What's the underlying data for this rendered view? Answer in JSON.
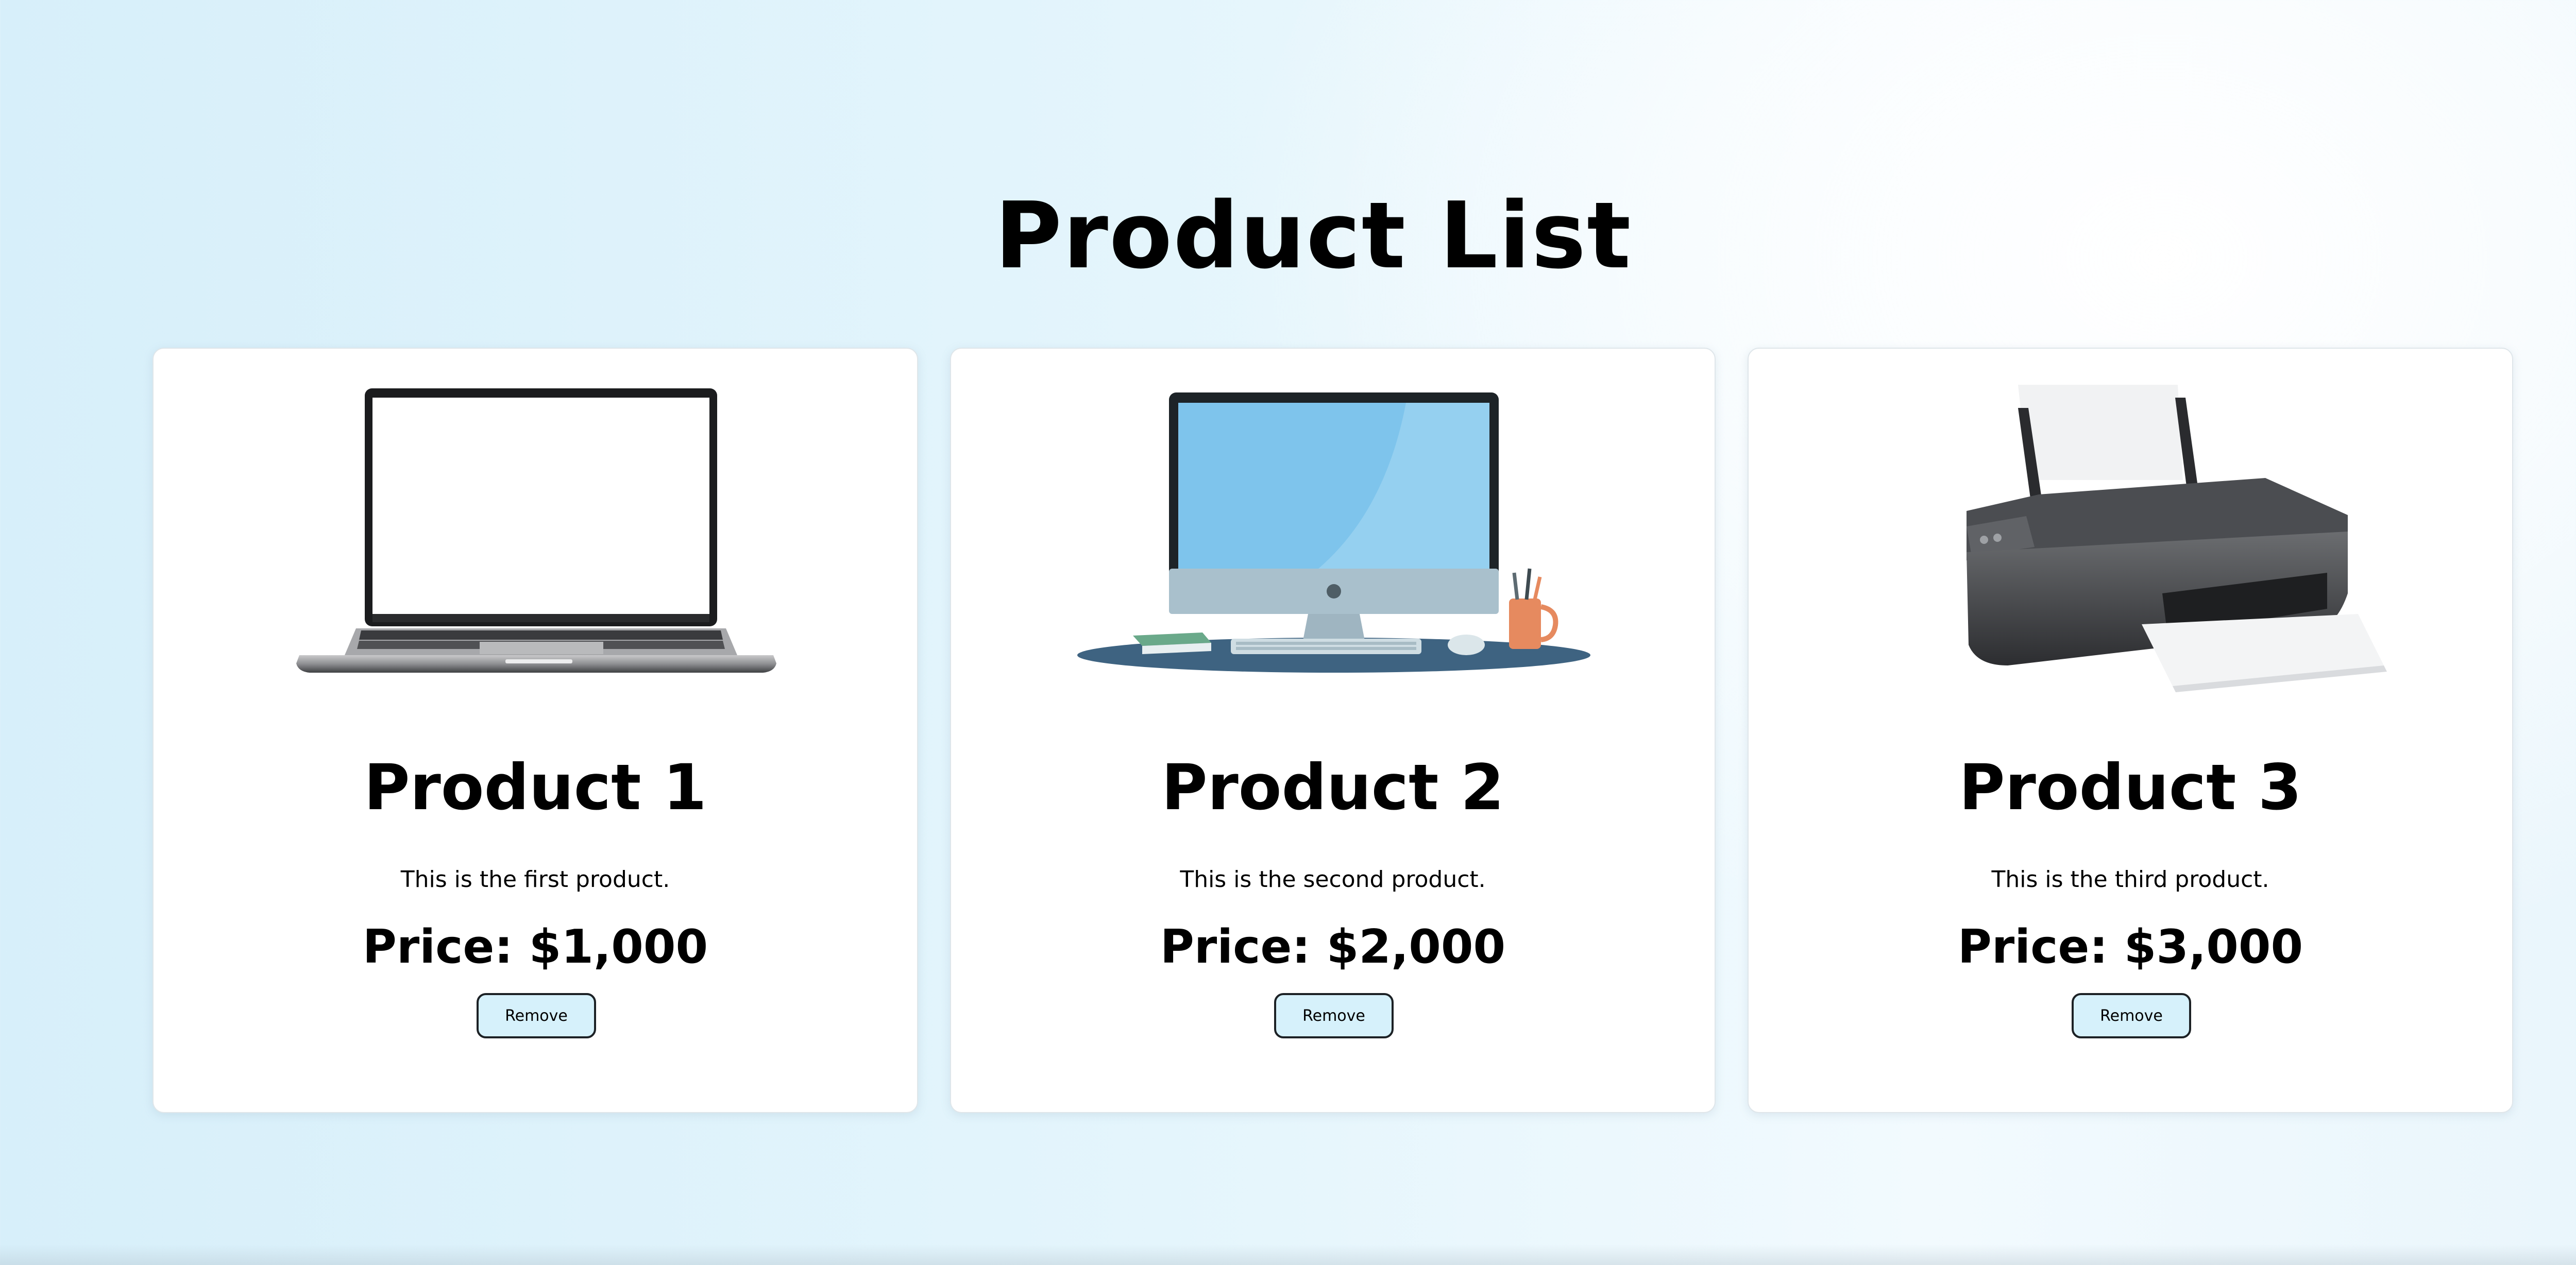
{
  "page": {
    "title": "Product List"
  },
  "products": [
    {
      "name": "Product 1",
      "description": "This is the first product.",
      "price": "Price: $1,000",
      "image_icon": "laptop-icon",
      "button_label": "Remove"
    },
    {
      "name": "Product 2",
      "description": "This is the second product.",
      "price": "Price: $2,000",
      "image_icon": "desktop-computer-icon",
      "button_label": "Remove"
    },
    {
      "name": "Product 3",
      "description": "This is the third product.",
      "price": "Price: $3,000",
      "image_icon": "printer-icon",
      "button_label": "Remove"
    }
  ],
  "colors": {
    "button_background": "#d6f1fb",
    "card_background": "#ffffff",
    "page_background": "#e4f5fc"
  }
}
